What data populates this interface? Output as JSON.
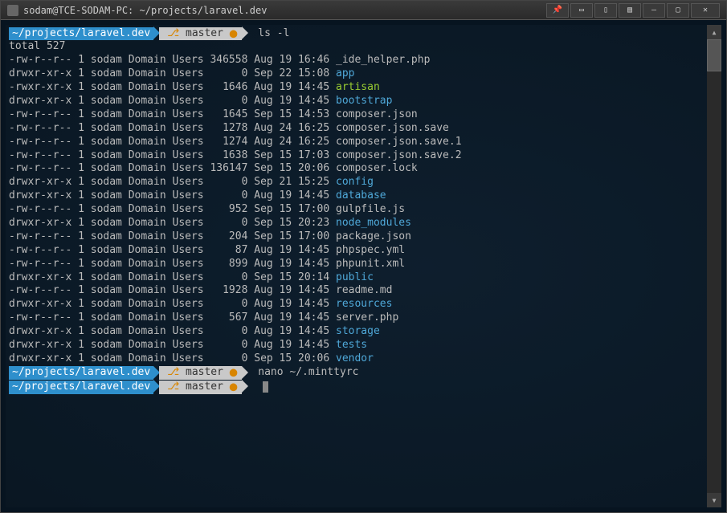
{
  "window": {
    "title": "sodam@TCE-SODAM-PC: ~/projects/laravel.dev"
  },
  "prompts": [
    {
      "path": "~/projects/laravel.dev",
      "branch": "master",
      "command": "ls -l"
    },
    {
      "path": "~/projects/laravel.dev",
      "branch": "master",
      "command": "nano ~/.minttyrc"
    },
    {
      "path": "~/projects/laravel.dev",
      "branch": "master",
      "command": ""
    }
  ],
  "total_line": "total 527",
  "ls_entries": [
    {
      "perms": "-rw-r--r--",
      "links": "1",
      "owner": "sodam",
      "group": "Domain Users",
      "size": "346558",
      "date": "Aug 19 16:46",
      "name": "_ide_helper.php",
      "type": "normal"
    },
    {
      "perms": "drwxr-xr-x",
      "links": "1",
      "owner": "sodam",
      "group": "Domain Users",
      "size": "0",
      "date": "Sep 22 15:08",
      "name": "app",
      "type": "dir"
    },
    {
      "perms": "-rwxr-xr-x",
      "links": "1",
      "owner": "sodam",
      "group": "Domain Users",
      "size": "1646",
      "date": "Aug 19 14:45",
      "name": "artisan",
      "type": "exec"
    },
    {
      "perms": "drwxr-xr-x",
      "links": "1",
      "owner": "sodam",
      "group": "Domain Users",
      "size": "0",
      "date": "Aug 19 14:45",
      "name": "bootstrap",
      "type": "dir"
    },
    {
      "perms": "-rw-r--r--",
      "links": "1",
      "owner": "sodam",
      "group": "Domain Users",
      "size": "1645",
      "date": "Sep 15 14:53",
      "name": "composer.json",
      "type": "normal"
    },
    {
      "perms": "-rw-r--r--",
      "links": "1",
      "owner": "sodam",
      "group": "Domain Users",
      "size": "1278",
      "date": "Aug 24 16:25",
      "name": "composer.json.save",
      "type": "normal"
    },
    {
      "perms": "-rw-r--r--",
      "links": "1",
      "owner": "sodam",
      "group": "Domain Users",
      "size": "1274",
      "date": "Aug 24 16:25",
      "name": "composer.json.save.1",
      "type": "normal"
    },
    {
      "perms": "-rw-r--r--",
      "links": "1",
      "owner": "sodam",
      "group": "Domain Users",
      "size": "1638",
      "date": "Sep 15 17:03",
      "name": "composer.json.save.2",
      "type": "normal"
    },
    {
      "perms": "-rw-r--r--",
      "links": "1",
      "owner": "sodam",
      "group": "Domain Users",
      "size": "136147",
      "date": "Sep 15 20:06",
      "name": "composer.lock",
      "type": "normal"
    },
    {
      "perms": "drwxr-xr-x",
      "links": "1",
      "owner": "sodam",
      "group": "Domain Users",
      "size": "0",
      "date": "Sep 21 15:25",
      "name": "config",
      "type": "dir"
    },
    {
      "perms": "drwxr-xr-x",
      "links": "1",
      "owner": "sodam",
      "group": "Domain Users",
      "size": "0",
      "date": "Aug 19 14:45",
      "name": "database",
      "type": "dir"
    },
    {
      "perms": "-rw-r--r--",
      "links": "1",
      "owner": "sodam",
      "group": "Domain Users",
      "size": "952",
      "date": "Sep 15 17:00",
      "name": "gulpfile.js",
      "type": "normal"
    },
    {
      "perms": "drwxr-xr-x",
      "links": "1",
      "owner": "sodam",
      "group": "Domain Users",
      "size": "0",
      "date": "Sep 15 20:23",
      "name": "node_modules",
      "type": "dir"
    },
    {
      "perms": "-rw-r--r--",
      "links": "1",
      "owner": "sodam",
      "group": "Domain Users",
      "size": "204",
      "date": "Sep 15 17:00",
      "name": "package.json",
      "type": "normal"
    },
    {
      "perms": "-rw-r--r--",
      "links": "1",
      "owner": "sodam",
      "group": "Domain Users",
      "size": "87",
      "date": "Aug 19 14:45",
      "name": "phpspec.yml",
      "type": "normal"
    },
    {
      "perms": "-rw-r--r--",
      "links": "1",
      "owner": "sodam",
      "group": "Domain Users",
      "size": "899",
      "date": "Aug 19 14:45",
      "name": "phpunit.xml",
      "type": "normal"
    },
    {
      "perms": "drwxr-xr-x",
      "links": "1",
      "owner": "sodam",
      "group": "Domain Users",
      "size": "0",
      "date": "Sep 15 20:14",
      "name": "public",
      "type": "dir"
    },
    {
      "perms": "-rw-r--r--",
      "links": "1",
      "owner": "sodam",
      "group": "Domain Users",
      "size": "1928",
      "date": "Aug 19 14:45",
      "name": "readme.md",
      "type": "normal"
    },
    {
      "perms": "drwxr-xr-x",
      "links": "1",
      "owner": "sodam",
      "group": "Domain Users",
      "size": "0",
      "date": "Aug 19 14:45",
      "name": "resources",
      "type": "dir"
    },
    {
      "perms": "-rw-r--r--",
      "links": "1",
      "owner": "sodam",
      "group": "Domain Users",
      "size": "567",
      "date": "Aug 19 14:45",
      "name": "server.php",
      "type": "normal"
    },
    {
      "perms": "drwxr-xr-x",
      "links": "1",
      "owner": "sodam",
      "group": "Domain Users",
      "size": "0",
      "date": "Aug 19 14:45",
      "name": "storage",
      "type": "dir"
    },
    {
      "perms": "drwxr-xr-x",
      "links": "1",
      "owner": "sodam",
      "group": "Domain Users",
      "size": "0",
      "date": "Aug 19 14:45",
      "name": "tests",
      "type": "dir"
    },
    {
      "perms": "drwxr-xr-x",
      "links": "1",
      "owner": "sodam",
      "group": "Domain Users",
      "size": "0",
      "date": "Sep 15 20:06",
      "name": "vendor",
      "type": "dir"
    }
  ]
}
